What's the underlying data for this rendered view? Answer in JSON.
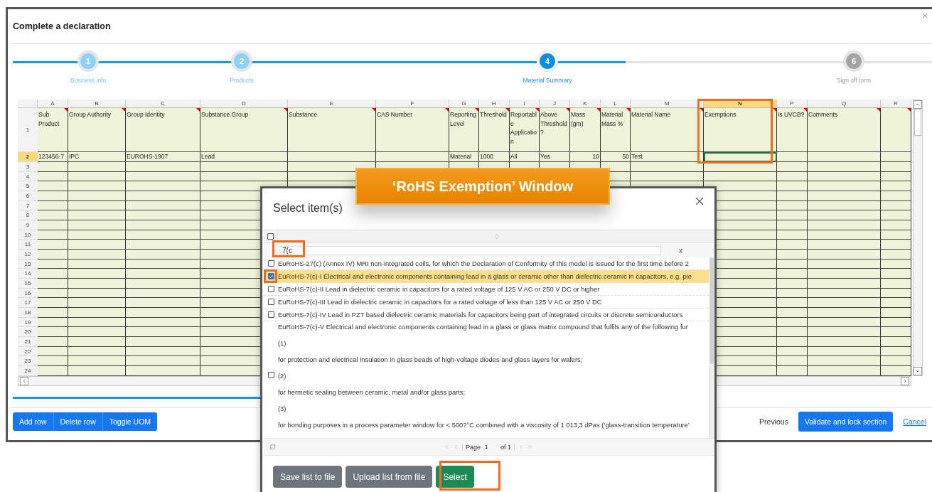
{
  "modal": {
    "title": "Complete a declaration"
  },
  "stepper": {
    "level": 0.667,
    "steps": [
      {
        "number": "1",
        "label": "Business info",
        "completed": true,
        "selected": false
      },
      {
        "number": "2",
        "label": "Products",
        "completed": true,
        "selected": false
      },
      {
        "number": "4",
        "label": "Material Summary",
        "completed": false,
        "selected": true
      },
      {
        "number": "6",
        "label": "Sign off form",
        "completed": false,
        "selected": false
      }
    ]
  },
  "sheet": {
    "columns": [
      {
        "letter": "A",
        "selected": false,
        "numeric": false
      },
      {
        "letter": "B",
        "selected": false,
        "numeric": false
      },
      {
        "letter": "C",
        "selected": false,
        "numeric": false
      },
      {
        "letter": "D",
        "selected": false,
        "numeric": false
      },
      {
        "letter": "E",
        "selected": false
      },
      {
        "letter": "F",
        "selected": false
      },
      {
        "letter": "G",
        "selected": false,
        "numeric": false
      },
      {
        "letter": "H",
        "selected": false,
        "numeric": false
      },
      {
        "letter": "I",
        "selected": false,
        "numeric": false
      },
      {
        "letter": "J",
        "selected": false,
        "numeric": false
      },
      {
        "letter": "K",
        "selected": false,
        "numeric": true
      },
      {
        "letter": "L",
        "selected": false,
        "numeric": true
      },
      {
        "letter": "M",
        "selected": false,
        "numeric": false
      },
      {
        "letter": "N",
        "selected": true
      },
      {
        "letter": "P",
        "selected": false
      },
      {
        "letter": "Q",
        "selected": false
      },
      {
        "letter": "R",
        "selected": false
      }
    ],
    "rows": [
      {
        "number": "1",
        "kind": "header",
        "selected": false,
        "cells": [
          "Sub Product",
          "Group Authority",
          "Group Identity",
          "Substance Group",
          "Substance",
          "CAS Number",
          "Reporting Level",
          "Threshold",
          "Reportable Application",
          "Above Threshold?",
          "Mass (gm)",
          "Material Mass %",
          "Material Name",
          "Exemptions",
          "Is UVCB?",
          "Comments",
          null
        ]
      },
      {
        "number": "2",
        "kind": "data",
        "selected": true,
        "cells": [
          "123456-7",
          "IPC",
          "EUROHS-1907",
          "Lead",
          null,
          null,
          "Material",
          "1000",
          "All",
          "Yes",
          "10",
          "50",
          "Test",
          null,
          null,
          null,
          null
        ]
      },
      {
        "number": "3",
        "kind": "blank",
        "selected": false
      },
      {
        "number": "4",
        "kind": "blank",
        "selected": false
      },
      {
        "number": "5",
        "kind": "blank",
        "selected": false
      },
      {
        "number": "6",
        "kind": "blank",
        "selected": false
      },
      {
        "number": "7",
        "kind": "blank",
        "selected": false
      },
      {
        "number": "8",
        "kind": "blank",
        "selected": false
      },
      {
        "number": "9",
        "kind": "blank",
        "selected": false
      },
      {
        "number": "10",
        "kind": "blank",
        "selected": false
      },
      {
        "number": "11",
        "kind": "blank",
        "selected": false
      },
      {
        "number": "12",
        "kind": "blank",
        "selected": false
      },
      {
        "number": "13",
        "kind": "blank",
        "selected": false
      },
      {
        "number": "14",
        "kind": "blank",
        "selected": false
      },
      {
        "number": "15",
        "kind": "blank",
        "selected": false
      },
      {
        "number": "16",
        "kind": "blank",
        "selected": false
      },
      {
        "number": "17",
        "kind": "blank",
        "selected": false
      },
      {
        "number": "18",
        "kind": "blank",
        "selected": false
      },
      {
        "number": "19",
        "kind": "blank",
        "selected": false
      },
      {
        "number": "20",
        "kind": "blank",
        "selected": false
      },
      {
        "number": "21",
        "kind": "blank",
        "selected": false
      },
      {
        "number": "22",
        "kind": "blank",
        "selected": false
      },
      {
        "number": "23",
        "kind": "blank",
        "selected": false
      },
      {
        "number": "24",
        "kind": "blank",
        "selected": false
      }
    ]
  },
  "footer": {
    "row_buttons": [
      "Add row",
      "Delete row",
      "Toggle UOM"
    ],
    "previous": "Previous",
    "validate": "Validate and lock section",
    "cancel": "Cancel"
  },
  "callout": {
    "text": "‘RoHS Exemption’ Window"
  },
  "dialog": {
    "title": "Select item(s)",
    "select_all_checked": false,
    "filter": {
      "value": "7(c",
      "clear": "x"
    },
    "items": [
      {
        "lines": [
          "EuRoHS-27(c) (Annex IV) MRI non-integrated coils, for which the Declaration of Conformity of this model is issued for the first time before 2"
        ],
        "checked": false,
        "selected": false
      },
      {
        "lines": [
          "EuRoHS-7(c)-I Electrical and electronic components containing lead in a glass or ceramic other than dielectric ceramic in capacitors, e.g. pie"
        ],
        "checked": true,
        "selected": true
      },
      {
        "lines": [
          "EuRoHS-7(c)-II Lead in dielectric ceramic in capacitors for a rated voltage of 125 V AC or 250 V DC or higher"
        ],
        "checked": false,
        "selected": false
      },
      {
        "lines": [
          "EuRoHS-7(c)-III Lead in dielectric ceramic in capacitors for a rated voltage of less than 125 V AC or 250 V DC"
        ],
        "checked": false,
        "selected": false
      },
      {
        "lines": [
          "EuRoHS-7(c)-IV Lead in PZT based dielectric ceramic materials for capacitors being part of integrated circuits or discrete semiconductors"
        ],
        "checked": false,
        "selected": false
      },
      {
        "lines": [
          "EuRoHS-7(c)-V Electrical and electronic components containing lead in a glass or glass matrix compound that fulfils any of the following fur",
          "(1)",
          "for protection and electrical insulation in glass beads of high-voltage diodes and glass layers for wafers;",
          "(2)",
          "for hermetic sealing between ceramic, metal and/or glass parts;",
          "(3)",
          "for bonding purposes in a process parameter window for < 500?°C combined with a viscosity of 1 013,3 dPas (‘glass-transition temperature’"
        ],
        "checked": false,
        "selected": false
      }
    ],
    "pager": {
      "page_label": "Page",
      "page": "1",
      "of": "of 1"
    },
    "buttons": [
      {
        "label": "Save list to file",
        "kind": "secondary"
      },
      {
        "label": "Upload list from file",
        "kind": "secondary"
      },
      {
        "label": "Select",
        "kind": "primary"
      }
    ]
  }
}
